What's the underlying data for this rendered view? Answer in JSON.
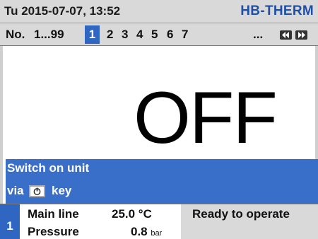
{
  "header": {
    "datetime": "Tu 2015-07-07, 13:52",
    "brand": "HB-THERM"
  },
  "unit_bar": {
    "label": "No.",
    "range": "1...99",
    "selected": "1",
    "units": [
      "2",
      "3",
      "4",
      "5",
      "6",
      "7"
    ],
    "dots": "...",
    "prev_icon": "rewind-icon",
    "next_icon": "fast-forward-icon"
  },
  "main": {
    "state": "OFF",
    "message_line1": "Switch on unit",
    "message_via": "via",
    "message_key": "key",
    "key_icon": "power-key-icon"
  },
  "status": {
    "unit_number": "1",
    "line_label": "Main line",
    "line_value": "25.0 °C",
    "pressure_label": "Pressure",
    "pressure_value": "0.8",
    "pressure_unit": "bar",
    "ready_text": "Ready to operate"
  },
  "colors": {
    "accent_blue": "#2f66c2",
    "message_blue": "#3a6fc9",
    "brand_blue": "#1f4fa6",
    "bar_grey": "#d9d9d9"
  }
}
